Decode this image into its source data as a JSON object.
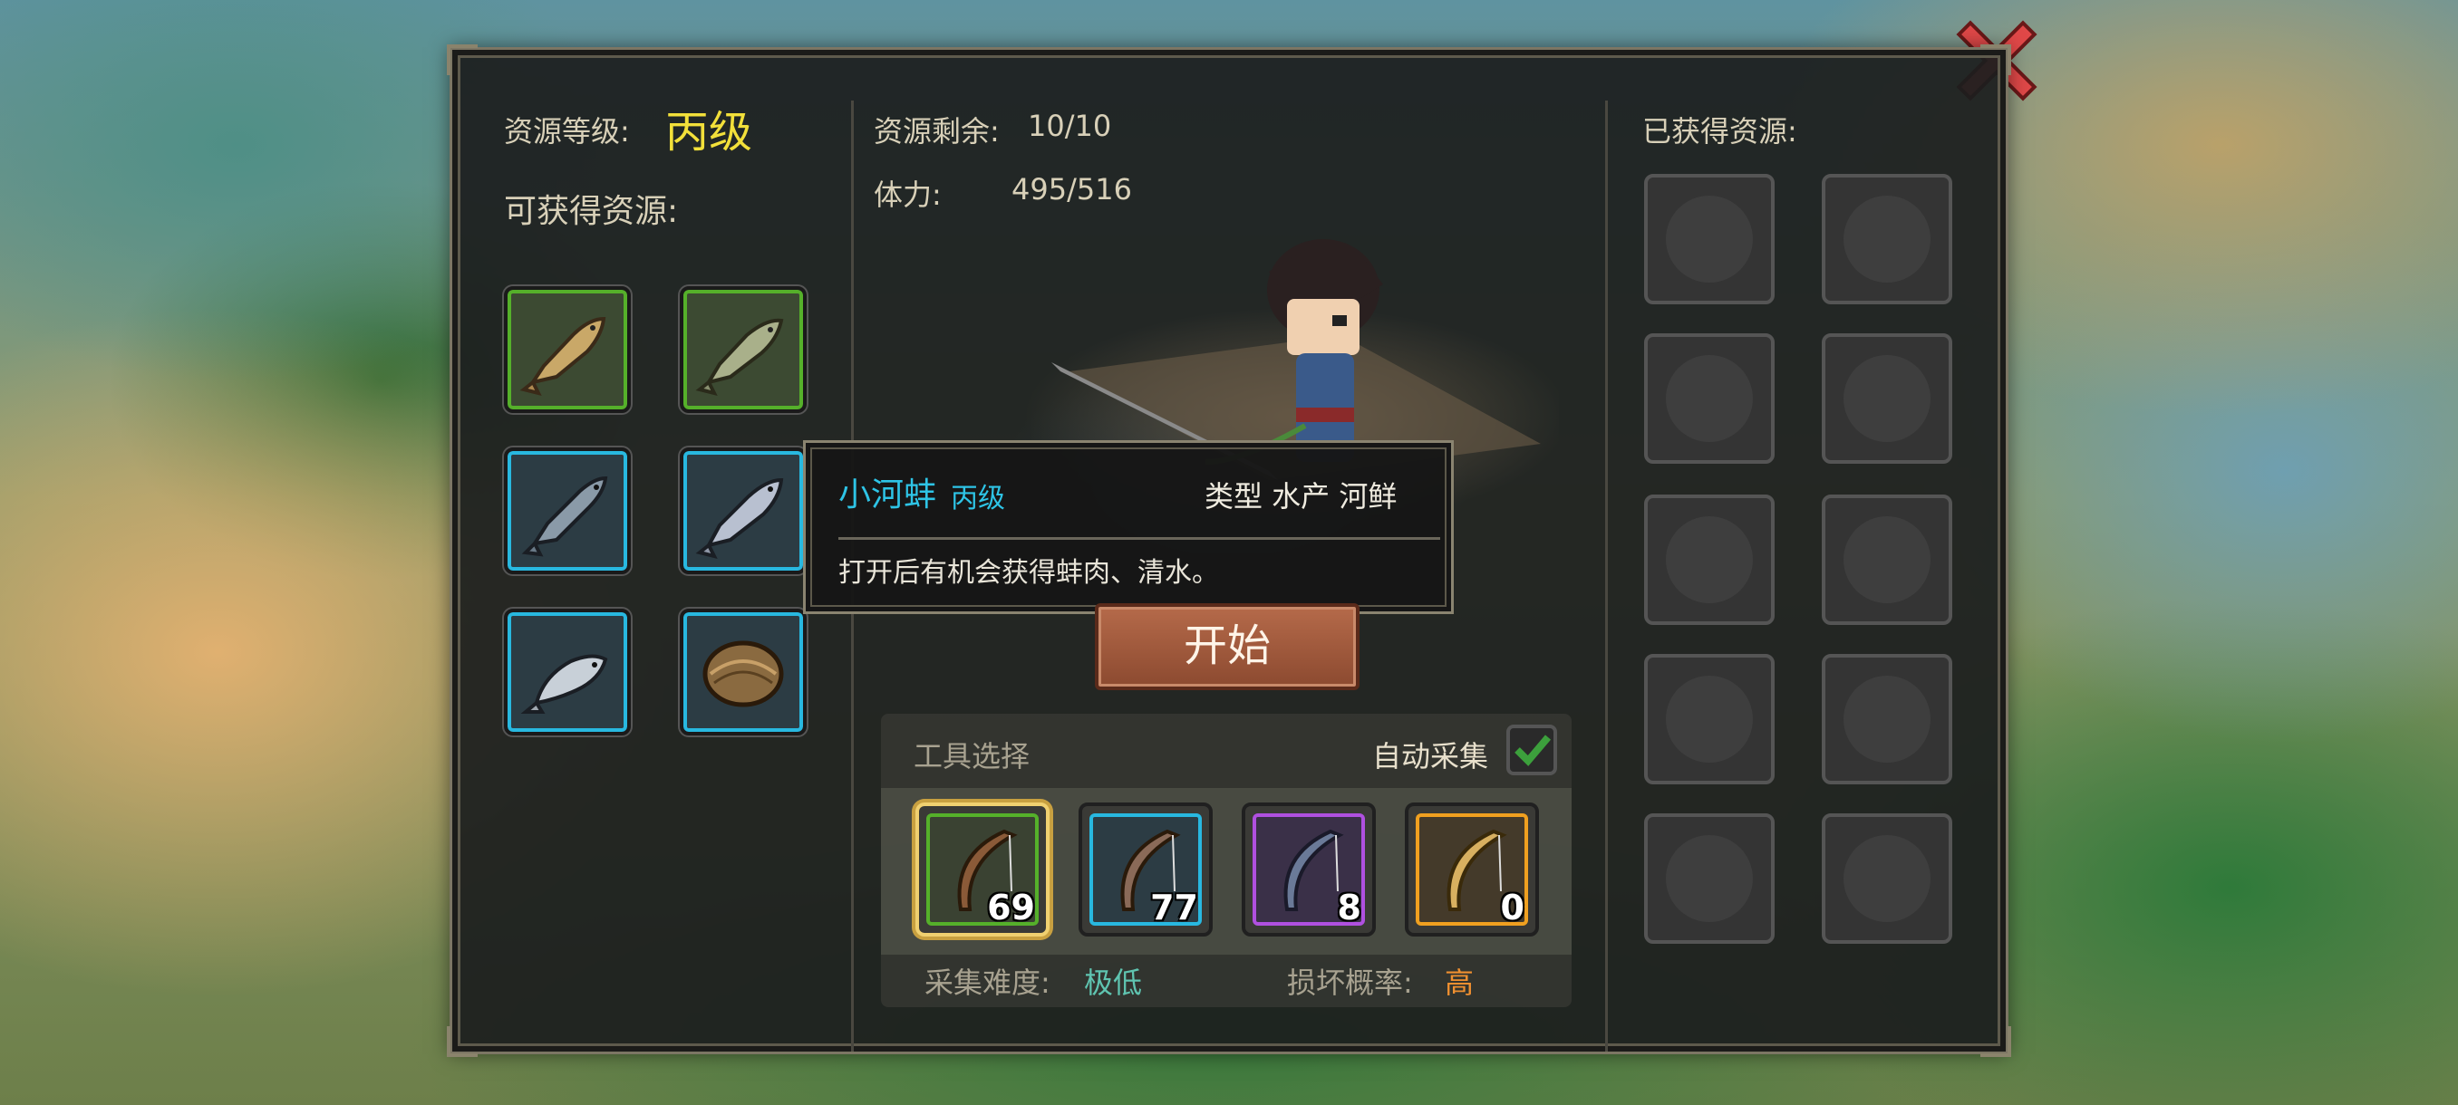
{
  "header": {
    "grade_label": "资源等级:",
    "grade_value": "丙级",
    "available_label": "可获得资源:",
    "remaining_label": "资源剩余:",
    "remaining_value": "10/10",
    "stamina_label": "体力:",
    "stamina_value": "495/516",
    "obtained_label": "已获得资源:"
  },
  "resources": [
    {
      "name": "fish-icon",
      "rarity": "green"
    },
    {
      "name": "fish-icon",
      "rarity": "green"
    },
    {
      "name": "fish-icon",
      "rarity": "blue"
    },
    {
      "name": "fish-icon",
      "rarity": "blue"
    },
    {
      "name": "fish-icon",
      "rarity": "blue"
    },
    {
      "name": "clam-icon",
      "rarity": "blue"
    }
  ],
  "tooltip": {
    "item_name": "小河蚌",
    "item_grade": "丙级",
    "type_text": "类型  水产 河鲜",
    "description": "打开后有机会获得蚌肉、清水。"
  },
  "start_button": "开始",
  "tools": {
    "section_label": "工具选择",
    "auto_label": "自动采集",
    "auto_checked": true,
    "items": [
      {
        "count": "69",
        "rarity": "green",
        "selected": true
      },
      {
        "count": "77",
        "rarity": "blue",
        "selected": false
      },
      {
        "count": "8",
        "rarity": "purple",
        "selected": false
      },
      {
        "count": "0",
        "rarity": "orange",
        "selected": false
      }
    ],
    "difficulty_label": "采集难度:",
    "difficulty_value": "极低",
    "damage_label": "损坏概率:",
    "damage_value": "高"
  },
  "colors": {
    "grade": "#f2e03a",
    "tooltip_name": "#2ec4e6",
    "difficulty": "#5fc4b0",
    "damage": "#f09030"
  }
}
